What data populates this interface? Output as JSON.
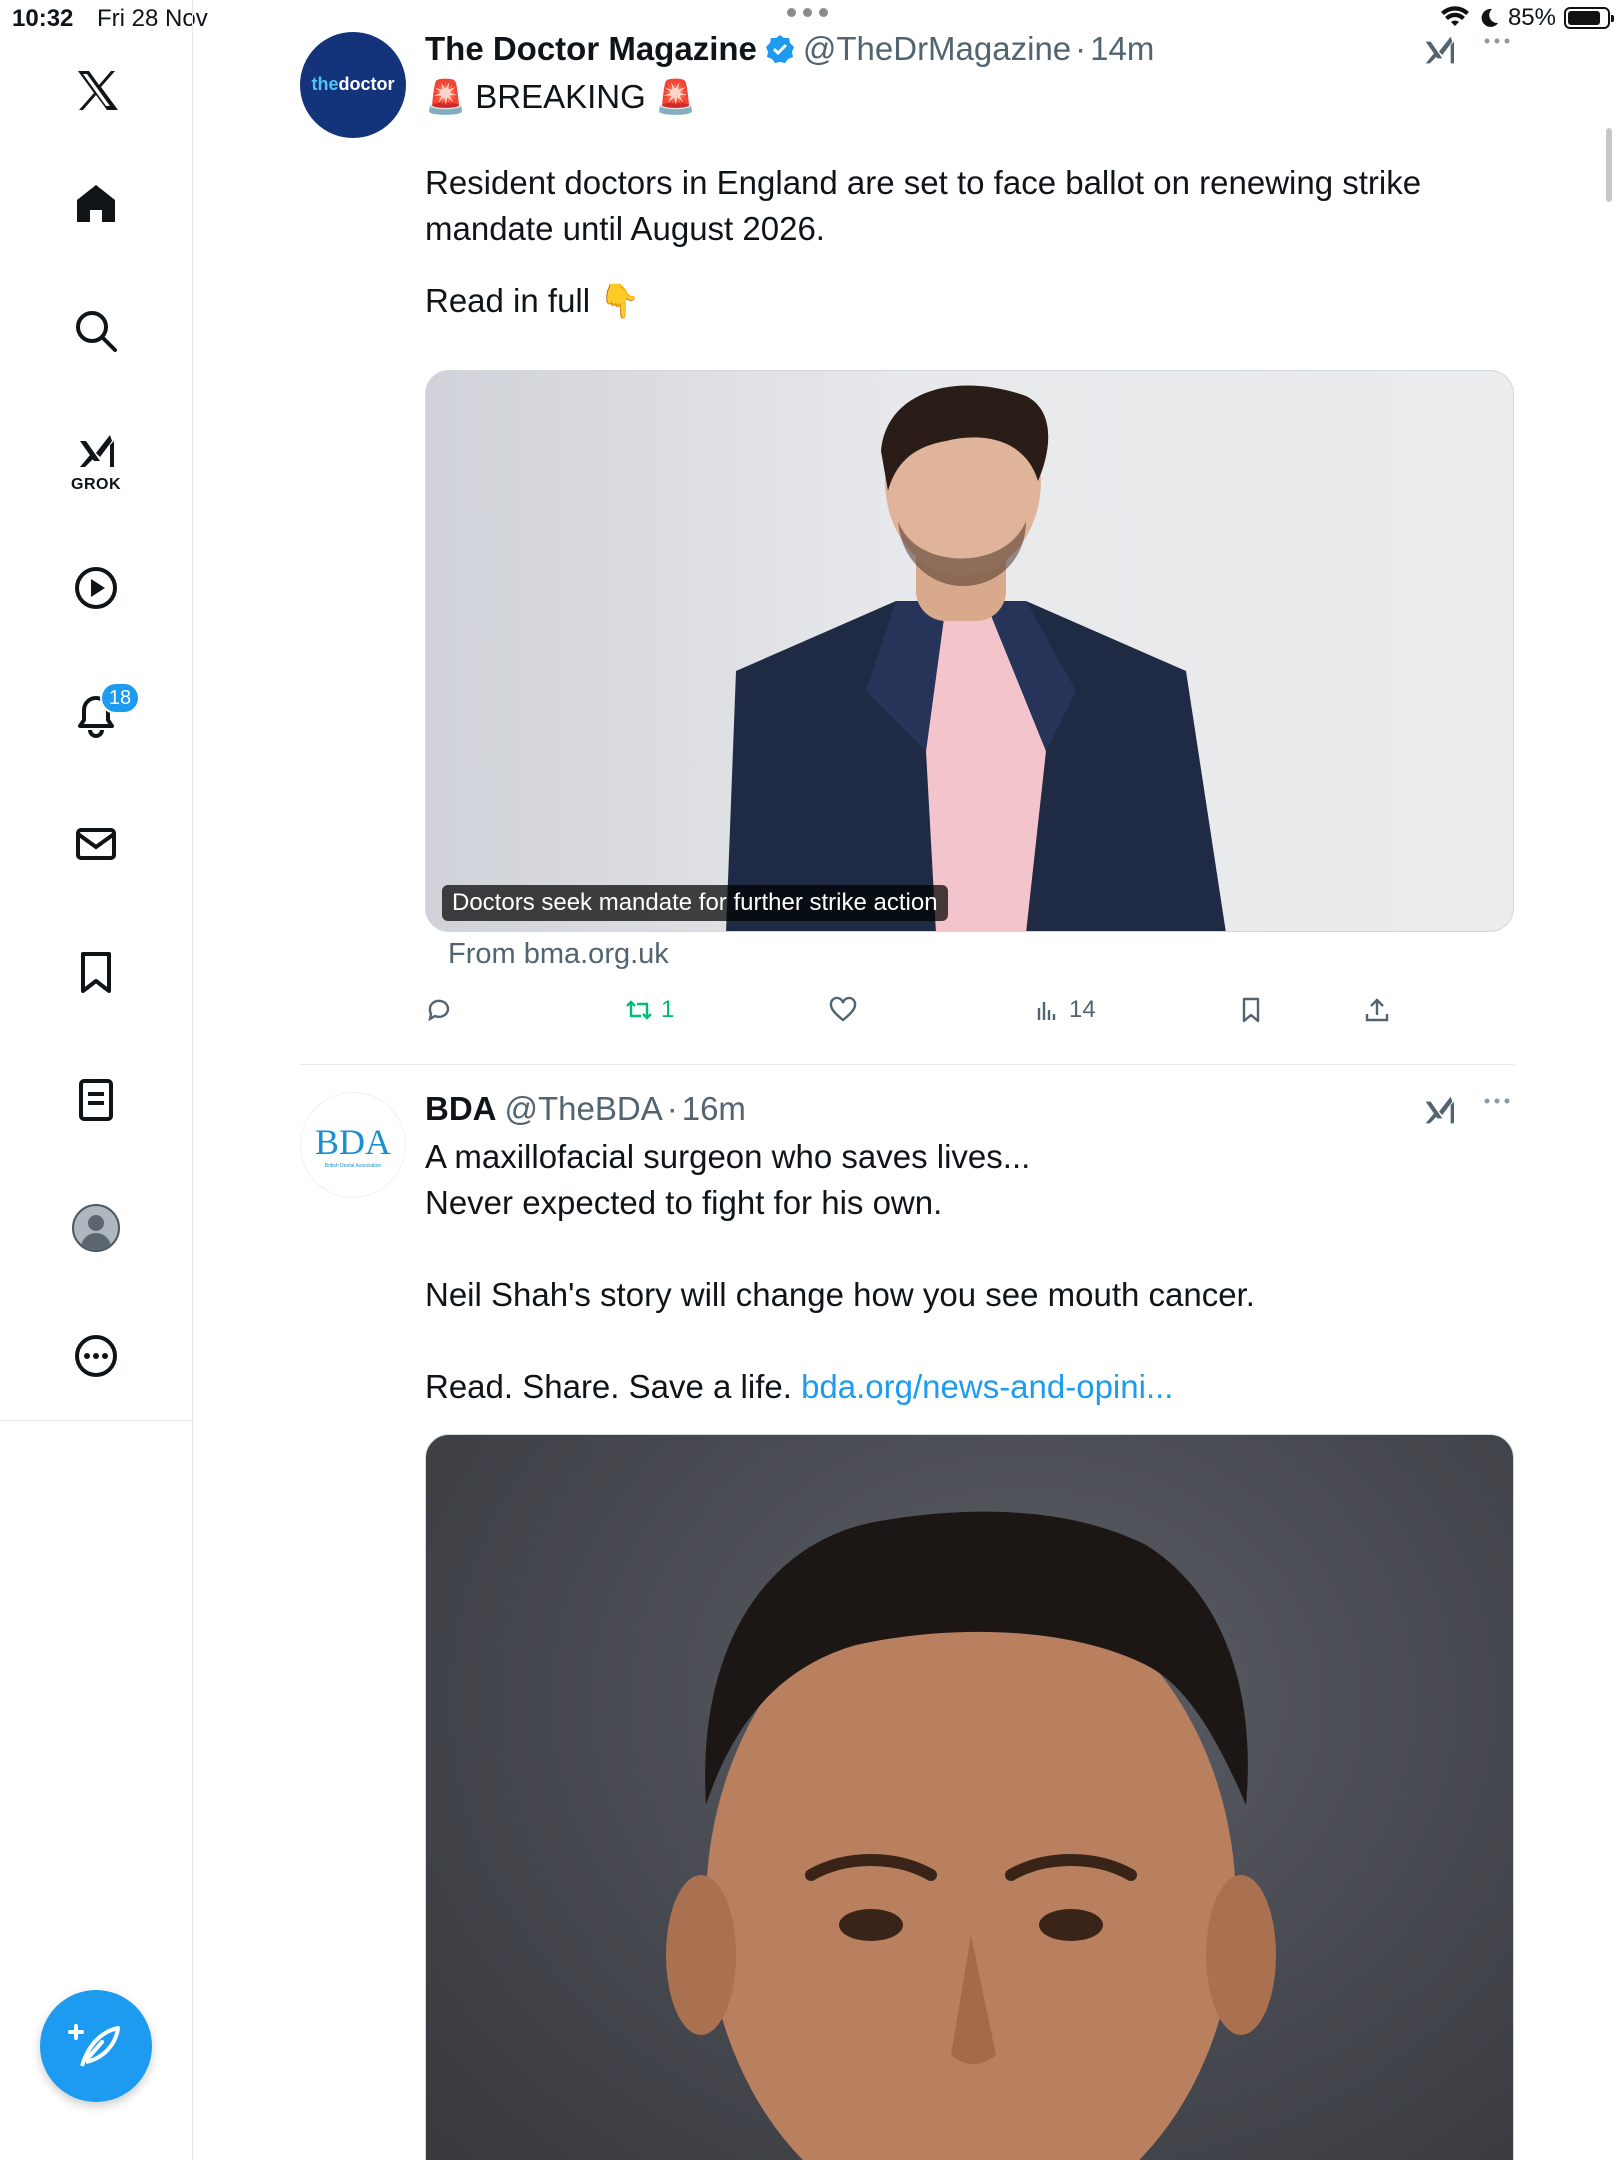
{
  "status_bar": {
    "time": "10:32",
    "date": "Fri 28 Nov",
    "battery": "85%",
    "battery_level": 0.85
  },
  "sidebar": {
    "grok_label": "GROK",
    "notifications_count": "18"
  },
  "tweets": [
    {
      "avatar_text_a": "the",
      "avatar_text_b": "doctor",
      "name": "The Doctor Magazine",
      "handle": "@TheDrMagazine",
      "separator": "·",
      "time": "14m",
      "line1_emoji_a": "🚨",
      "line1_text": "BREAKING",
      "line1_emoji_b": "🚨",
      "paragraph": "Resident doctors in England are set to face ballot on renewing strike mandate until August 2026.",
      "read_more": "Read in full",
      "read_more_emoji": "👇",
      "media_caption": "Doctors seek mandate for further strike action",
      "source": "From bma.org.uk",
      "stats": {
        "replies": "",
        "retweets": "1",
        "likes": "",
        "views": "14"
      }
    },
    {
      "avatar_text": "BDA",
      "avatar_subtext": "British Dental Association",
      "name": "BDA",
      "handle": "@TheBDA",
      "separator": "·",
      "time": "16m",
      "line1": "A maxillofacial surgeon who saves lives...",
      "line2": "Never expected to fight for his own.",
      "line3": "Neil Shah's story will change how you see mouth cancer.",
      "line4": "Read. Share. Save a life. ",
      "link": "bda.org/news-and-opini..."
    }
  ],
  "colors": {
    "accent": "#1d9bf0",
    "retweet_active": "#00ba7c",
    "secondary_text": "#536471",
    "doctor_avatar_bg": "#13337a"
  },
  "icons": {
    "nav": [
      "x-logo-icon",
      "home-icon",
      "search-icon",
      "grok-icon",
      "video-play-icon",
      "notifications-bell-icon",
      "messages-envelope-icon",
      "bookmarks-icon",
      "lists-icon",
      "profile-avatar",
      "more-circle-icon"
    ],
    "compose": "compose-post-icon"
  }
}
